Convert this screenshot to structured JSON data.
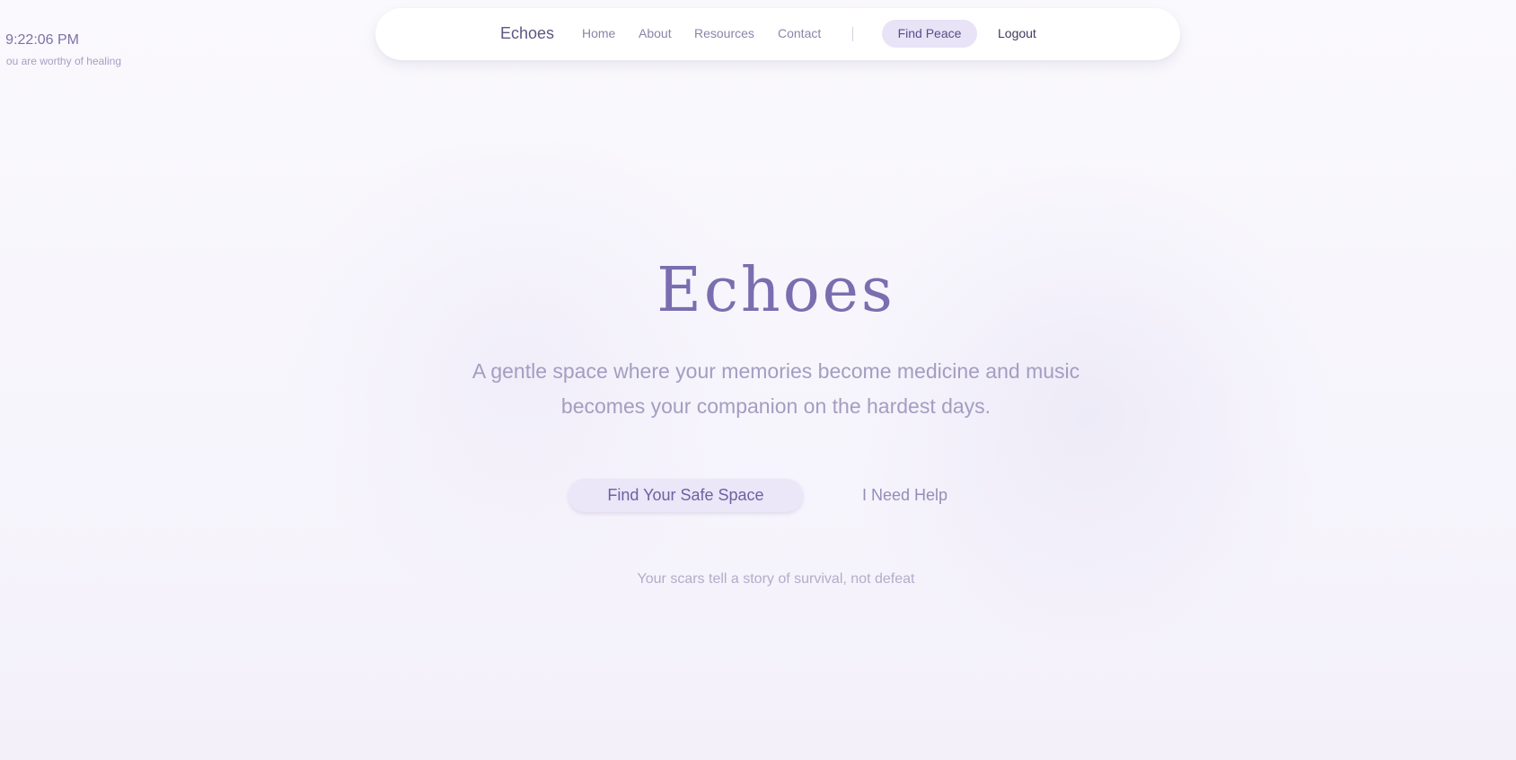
{
  "clock": {
    "time": "9:22:06 PM",
    "affirmation": "ou are worthy of healing"
  },
  "nav": {
    "brand": "Echoes",
    "links": [
      "Home",
      "About",
      "Resources",
      "Contact"
    ],
    "cta_label": "Find Peace",
    "logout_label": "Logout"
  },
  "hero": {
    "title": "Echoes",
    "subtitle": "A gentle space where your memories become medicine and music becomes your companion on the hardest days.",
    "primary_button": "Find Your Safe Space",
    "secondary_button": "I Need Help",
    "footnote": "Your scars tell a story of survival, not defeat"
  },
  "colors": {
    "accent": "#7a6eb0",
    "button_bg": "#ebe6f8",
    "background": "#f8f6fc"
  }
}
